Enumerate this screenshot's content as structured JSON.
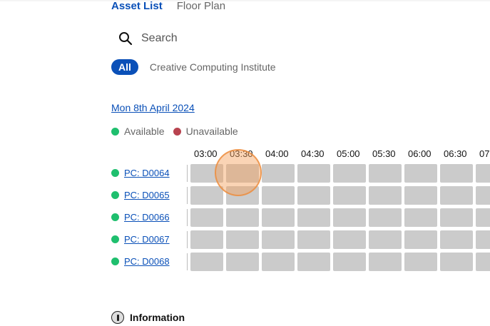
{
  "tabs": [
    {
      "label": "Asset List",
      "active": true
    },
    {
      "label": "Floor Plan",
      "active": false
    }
  ],
  "search": {
    "placeholder": "Search",
    "icon": "search-icon"
  },
  "filters": {
    "all_label": "All",
    "institute_label": "Creative Computing Institute"
  },
  "date_label": "Mon 8th April 2024",
  "legend": {
    "available": {
      "label": "Available",
      "color": "#1fbf6e"
    },
    "unavailable": {
      "label": "Unavailable",
      "color": "#b8434f"
    }
  },
  "times": [
    "03:00",
    "03:30",
    "04:00",
    "04:30",
    "05:00",
    "05:30",
    "06:00",
    "06:30",
    "07"
  ],
  "assets": [
    {
      "name": "PC: D0064",
      "status": "available"
    },
    {
      "name": "PC: D0065",
      "status": "available"
    },
    {
      "name": "PC: D0066",
      "status": "available"
    },
    {
      "name": "PC: D0067",
      "status": "available"
    },
    {
      "name": "PC: D0068",
      "status": "available"
    }
  ],
  "slot_color": "#cbcbcb",
  "information_label": "Information"
}
